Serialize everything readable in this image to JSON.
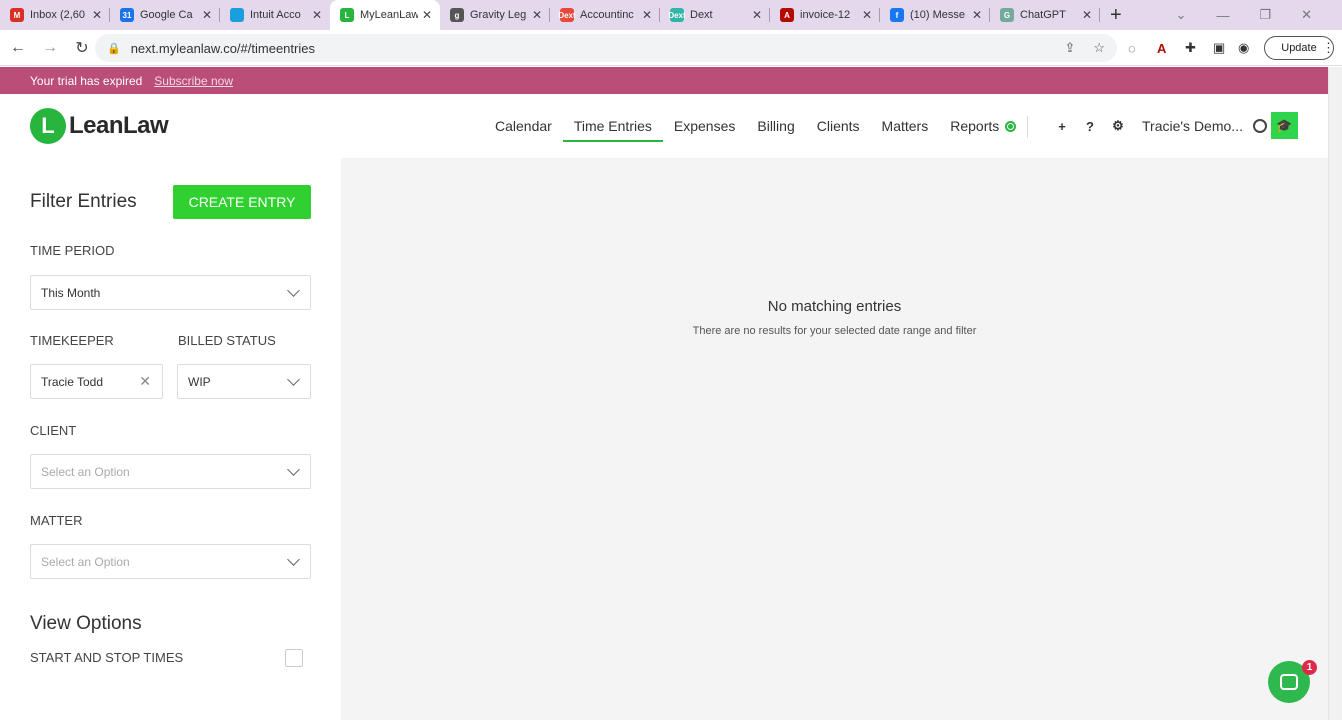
{
  "browser": {
    "tabs": [
      {
        "label": "Inbox (2,60",
        "icon": "gmail-icon",
        "color": "#d93025",
        "glyph": "M"
      },
      {
        "label": "Google Ca",
        "icon": "google-calendar-icon",
        "color": "#1a73e8",
        "glyph": "31"
      },
      {
        "label": "Intuit Acco",
        "icon": "intuit-icon",
        "color": "#1a9ee0",
        "glyph": ""
      },
      {
        "label": "MyLeanLaw",
        "icon": "leanlaw-icon",
        "color": "#27b53d",
        "glyph": "L"
      },
      {
        "label": "Gravity Leg",
        "icon": "gravity-legal-icon",
        "color": "#555555",
        "glyph": "g"
      },
      {
        "label": "Accountinc",
        "icon": "dext-icon",
        "color": "#e8483a",
        "glyph": "Dext"
      },
      {
        "label": "Dext",
        "icon": "dext-icon",
        "color": "#2fb6a8",
        "glyph": "Dext"
      },
      {
        "label": "invoice-12",
        "icon": "pdf-icon",
        "color": "#b30b00",
        "glyph": "A"
      },
      {
        "label": "(10) Messe",
        "icon": "facebook-icon",
        "color": "#1877f2",
        "glyph": "f"
      },
      {
        "label": "ChatGPT",
        "icon": "chatgpt-icon",
        "color": "#74aa9c",
        "glyph": "G"
      }
    ],
    "new_tab": "+",
    "url": "next.myleanlaw.co/#/timeentries",
    "update_label": "Update"
  },
  "banner": {
    "text": "Your trial has expired",
    "link": "Subscribe now"
  },
  "header": {
    "logo_mark": "L",
    "logo_text": "LeanLaw",
    "nav": [
      {
        "label": "Calendar"
      },
      {
        "label": "Time Entries",
        "active": true
      },
      {
        "label": "Expenses"
      },
      {
        "label": "Billing"
      },
      {
        "label": "Clients"
      },
      {
        "label": "Matters"
      },
      {
        "label": "Reports"
      }
    ],
    "user_name": "Tracie's Demo...",
    "accent": "#27b53d"
  },
  "filters": {
    "title": "Filter Entries",
    "create_label": "CREATE ENTRY",
    "time_period_label": "TIME PERIOD",
    "time_period_value": "This Month",
    "timekeeper_label": "TIMEKEEPER",
    "timekeeper_value": "Tracie Todd",
    "billed_status_label": "BILLED STATUS",
    "billed_status_value": "WIP",
    "client_label": "CLIENT",
    "client_placeholder": "Select an Option",
    "matter_label": "MATTER",
    "matter_placeholder": "Select an Option",
    "view_options_title": "View Options",
    "start_stop_label": "START AND STOP TIMES"
  },
  "main": {
    "empty_title": "No matching entries",
    "empty_subtitle": "There are no results for your selected date range and filter"
  },
  "chat": {
    "badge": "1"
  }
}
